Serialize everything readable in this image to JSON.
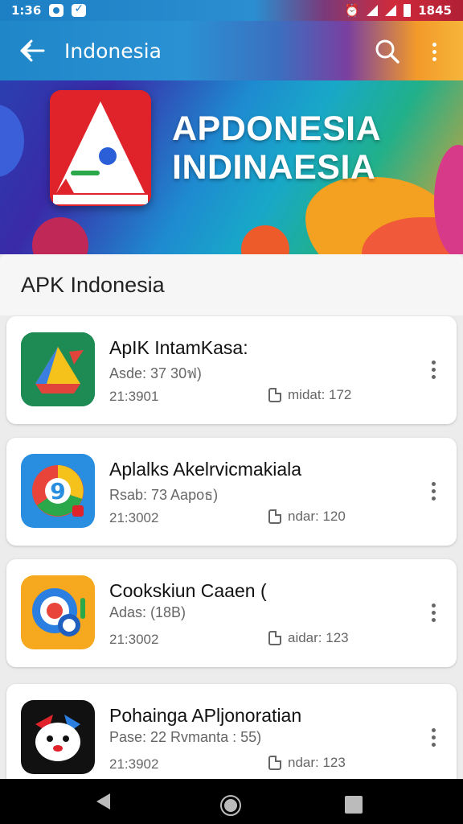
{
  "status_bar": {
    "time_left": "1:36",
    "time_right": "1845"
  },
  "app_bar": {
    "title": "Indonesia",
    "back_icon": "back-arrow-icon",
    "search_icon": "search-icon",
    "more_icon": "more-vert-icon"
  },
  "banner": {
    "title_line1": "APDONESIA",
    "title_line2": "INDINAESIA"
  },
  "section": {
    "title": "APK Indonesia"
  },
  "apps": [
    {
      "name": "ApIK IntamKasa:",
      "subtitle": "Asde: 37 30ฟ)",
      "size": "21:3901",
      "file_label": "midat: 172",
      "icon": "triangle-app-icon"
    },
    {
      "name": "Aplalks Akelrvicmakiala",
      "subtitle": "Rsab: 73 Aapoธ)",
      "size": "21:3002",
      "file_label": "ndar: 120",
      "icon": "chrome-style-app-icon"
    },
    {
      "name": "Cookskiun Caaen (",
      "subtitle": "Adas: (18B)",
      "size": "21:3002",
      "file_label": "aidar: 123",
      "icon": "search-lens-app-icon"
    },
    {
      "name": "Pohainga APljonoratian",
      "subtitle": "Pase: 22 Rvmanta : 55)",
      "size": "21:3902",
      "file_label": "ndar: 123",
      "icon": "mascot-app-icon"
    }
  ],
  "nav_bar": {
    "back": "nav-back-icon",
    "home": "nav-home-icon",
    "recents": "nav-recents-icon"
  }
}
